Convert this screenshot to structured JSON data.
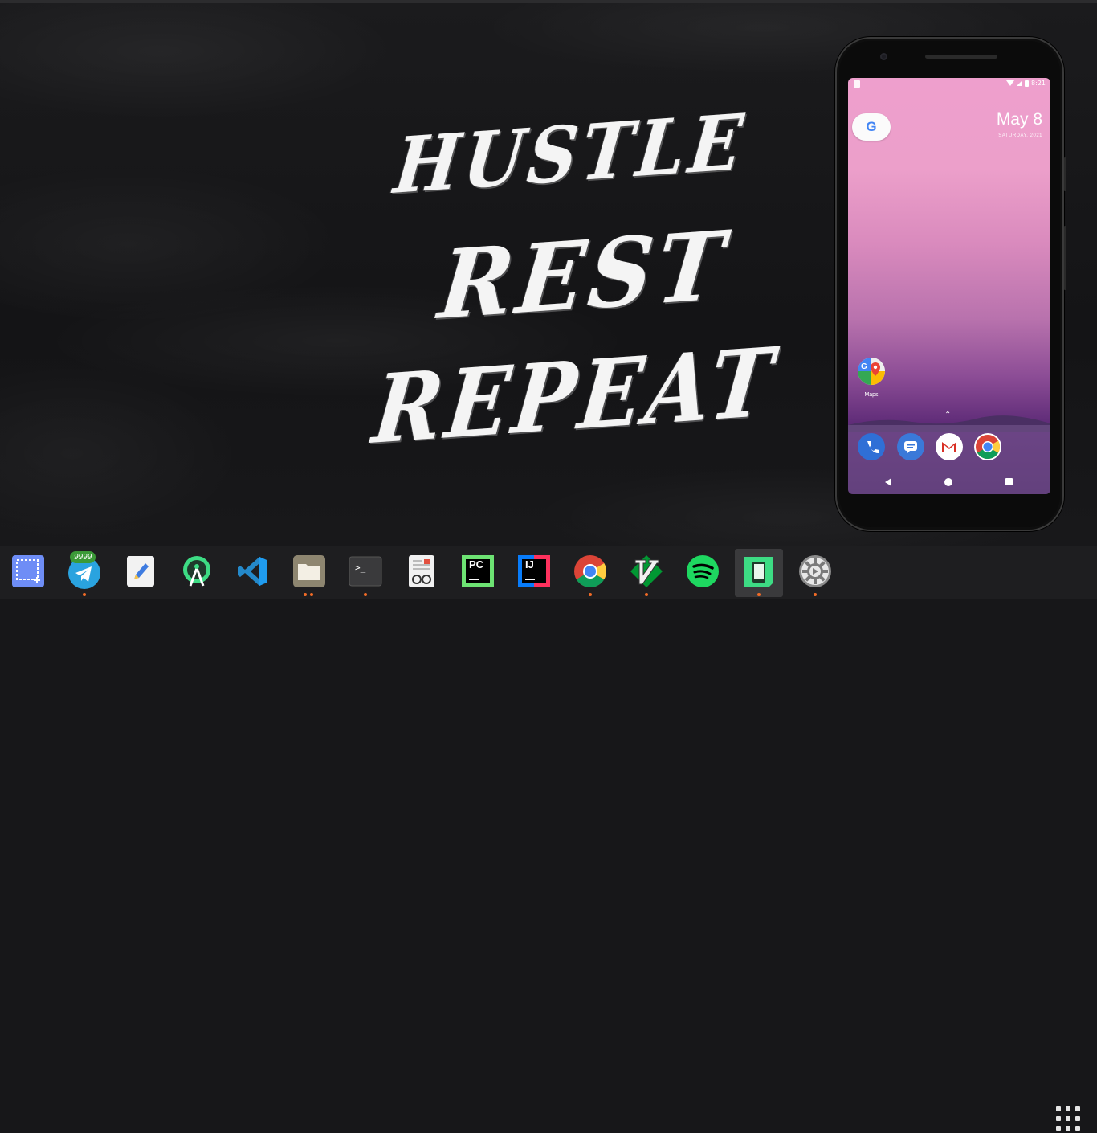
{
  "desktop": {
    "motto": [
      "HUSTLE",
      "REST",
      "REPEAT"
    ]
  },
  "phone": {
    "status_time": "8:21",
    "date": "May 8",
    "day": "SATURDAY, 2021",
    "google_letter": "G",
    "maps_label": "Maps",
    "dock_apps": [
      "phone-icon",
      "messages-icon",
      "gmail-icon",
      "chrome-icon"
    ]
  },
  "taskbar": {
    "apps": [
      {
        "name": "screenshot-app",
        "icon": "screenshot-icon",
        "open": false
      },
      {
        "name": "telegram",
        "icon": "telegram-icon",
        "open": true,
        "badge": "9999"
      },
      {
        "name": "text-editor",
        "icon": "text-editor-icon",
        "open": false
      },
      {
        "name": "android-studio",
        "icon": "android-studio-icon",
        "open": false
      },
      {
        "name": "vs-code",
        "icon": "vscode-icon",
        "open": false
      },
      {
        "name": "files",
        "icon": "folder-icon",
        "open": true,
        "windows": 2
      },
      {
        "name": "terminal",
        "icon": "terminal-icon",
        "open": true
      },
      {
        "name": "document-viewer",
        "icon": "document-viewer-icon",
        "open": false
      },
      {
        "name": "pycharm",
        "icon": "pycharm-icon",
        "open": false
      },
      {
        "name": "intellij",
        "icon": "intellij-icon",
        "open": false
      },
      {
        "name": "chrome",
        "icon": "chrome-icon",
        "open": true
      },
      {
        "name": "vim",
        "icon": "vim-icon",
        "open": true
      },
      {
        "name": "spotify",
        "icon": "spotify-icon",
        "open": false
      },
      {
        "name": "android-emulator",
        "icon": "emulator-icon",
        "open": true,
        "active": true
      },
      {
        "name": "settings",
        "icon": "settings-icon",
        "open": true
      }
    ],
    "pycharm_text": "PC",
    "intellij_text": "IJ",
    "terminal_prompt": ">_"
  },
  "colors": {
    "dot": "#f26b26",
    "badge": "#3b9a37",
    "taskbar": "#1e1e20"
  }
}
